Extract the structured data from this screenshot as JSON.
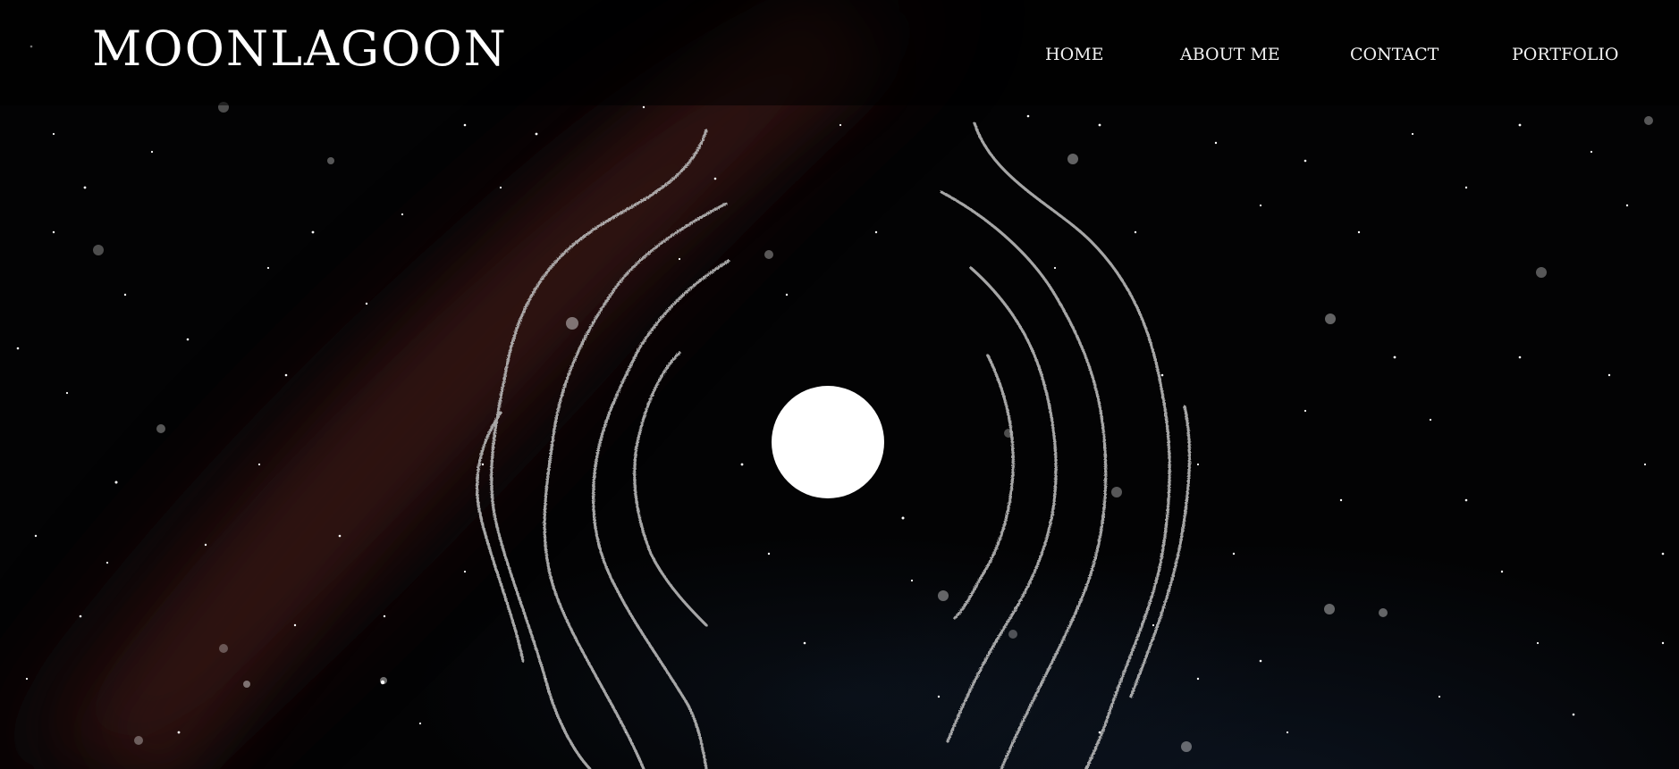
{
  "site": {
    "logo_text": "MOONLAGOON"
  },
  "nav": {
    "items": [
      {
        "label": "HOME"
      },
      {
        "label": "ABOUT ME"
      },
      {
        "label": "CONTACT"
      },
      {
        "label": "PORTFOLIO"
      }
    ]
  },
  "hero": {
    "moon_color": "#ffffff",
    "ripple_color": "#b8b8b8",
    "sky_color": "#030304",
    "milkyway_color": "#3a1414"
  }
}
